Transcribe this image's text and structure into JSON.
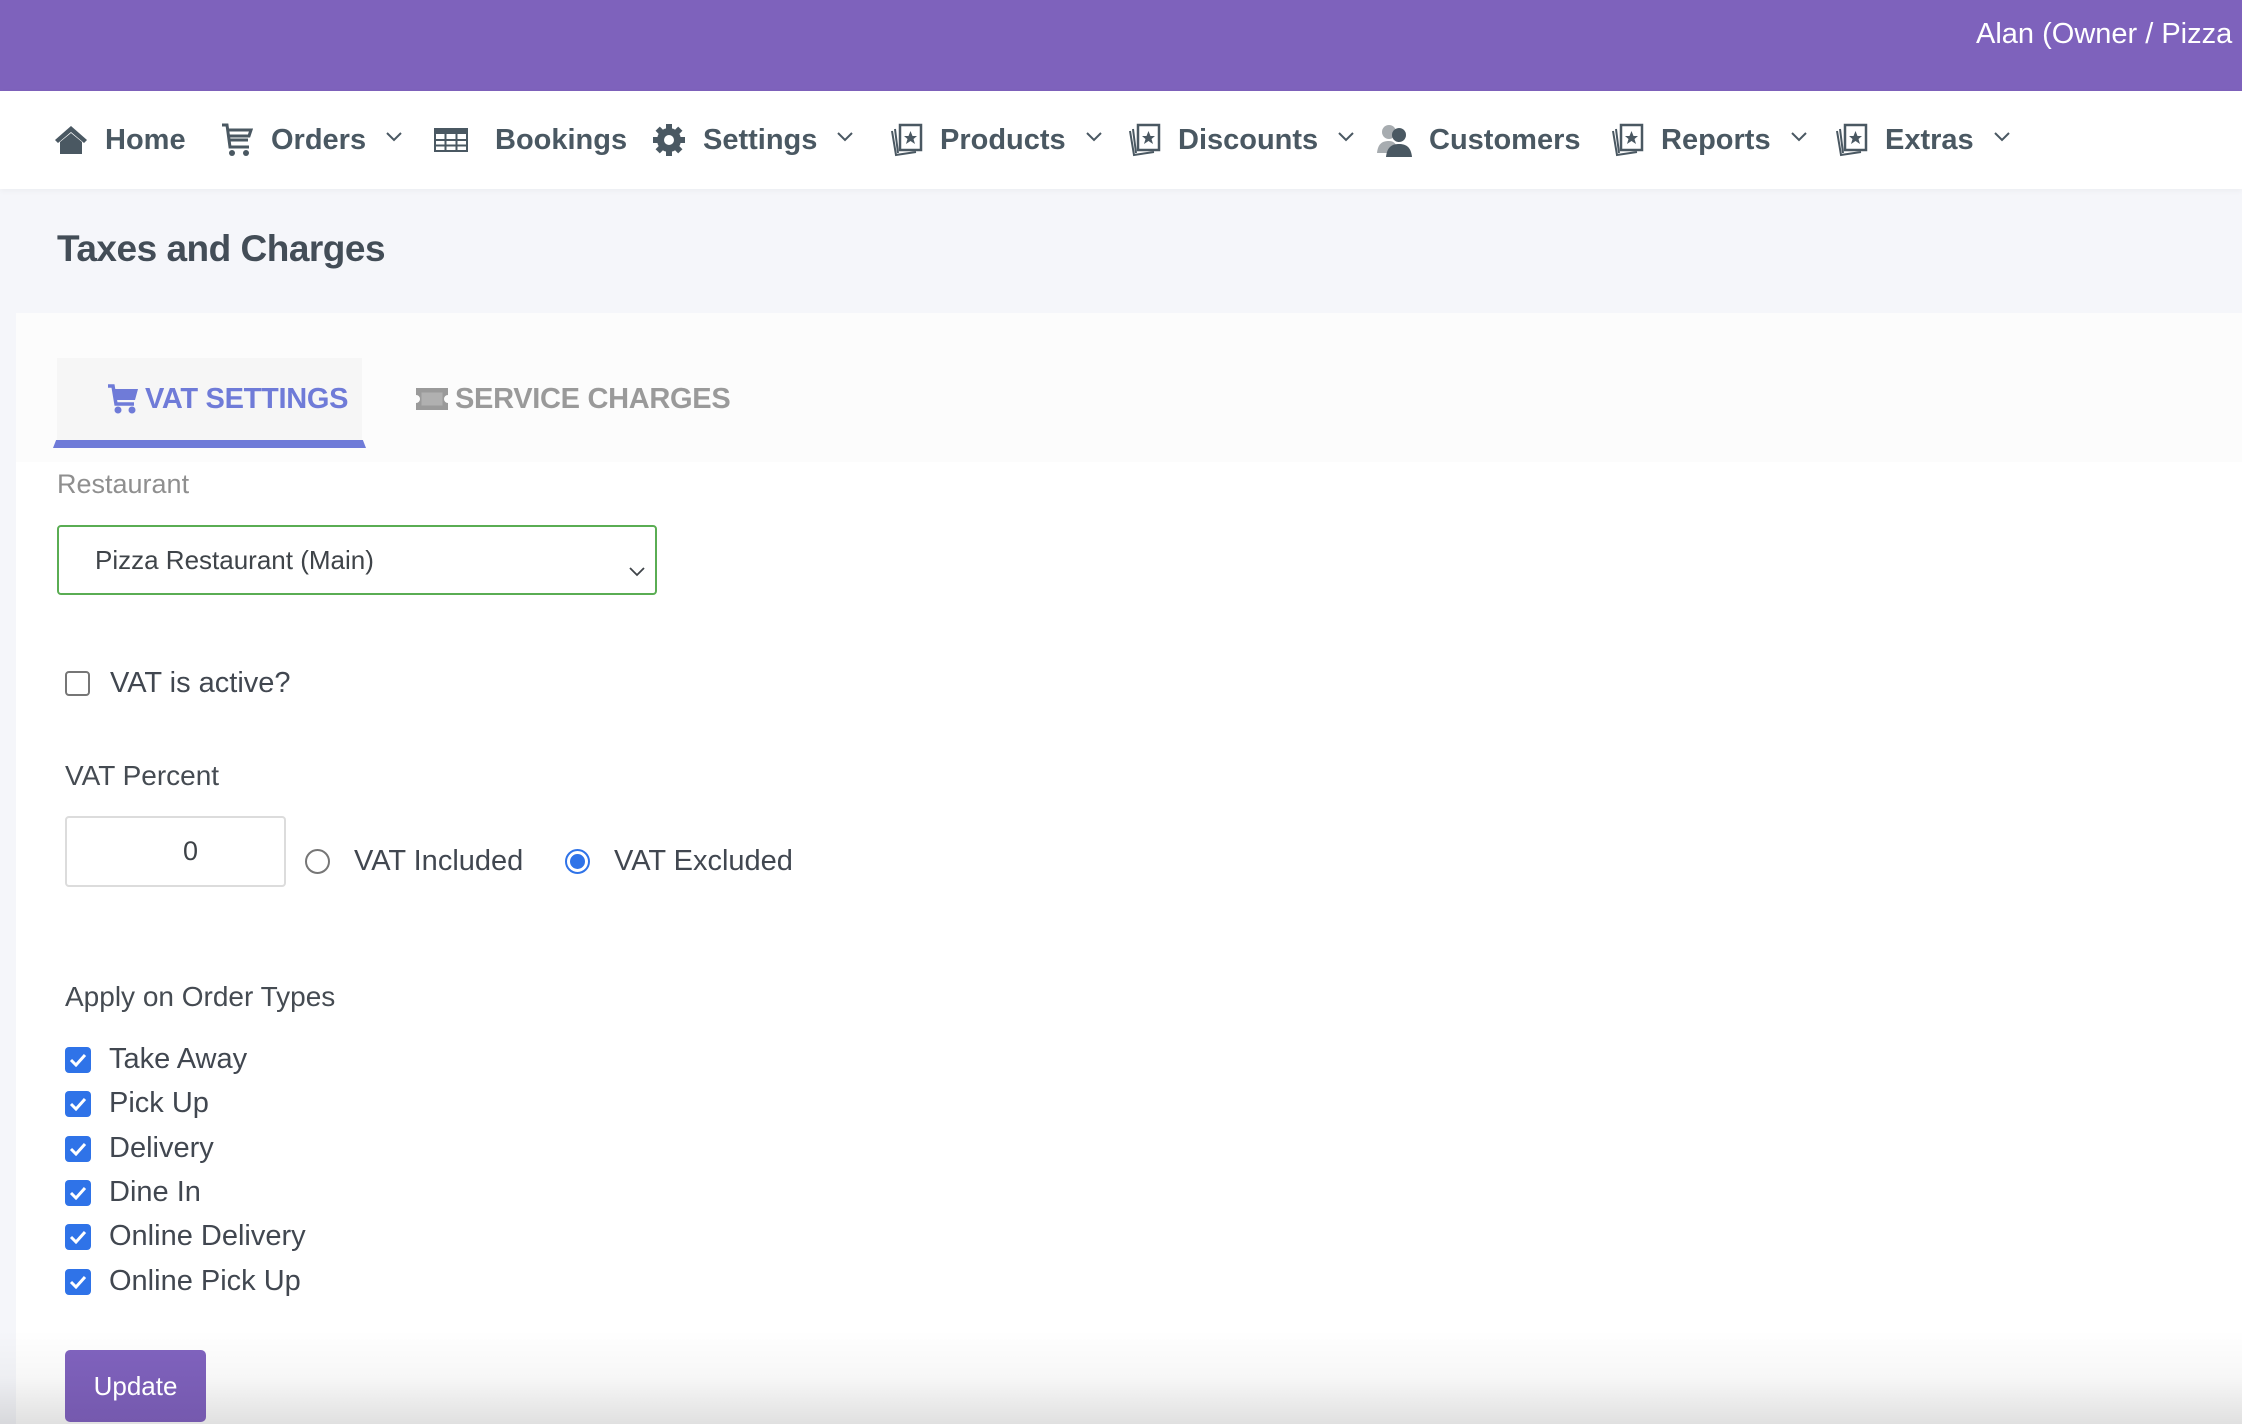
{
  "topbar": {
    "user_label": "Alan (Owner / Pizza R",
    "color": "#7e62bc"
  },
  "nav": {
    "items": [
      {
        "label": "Home",
        "icon": "home-icon",
        "has_dropdown": false
      },
      {
        "label": "Orders",
        "icon": "cart-icon",
        "has_dropdown": true
      },
      {
        "label": "Bookings",
        "icon": "table-icon",
        "has_dropdown": false
      },
      {
        "label": "Settings",
        "icon": "gear-icon",
        "has_dropdown": true
      },
      {
        "label": "Products",
        "icon": "cards-star-icon",
        "has_dropdown": true
      },
      {
        "label": "Discounts",
        "icon": "cards-star-icon",
        "has_dropdown": true
      },
      {
        "label": "Customers",
        "icon": "users-icon",
        "has_dropdown": false
      },
      {
        "label": "Reports",
        "icon": "cards-star-icon",
        "has_dropdown": true
      },
      {
        "label": "Extras",
        "icon": "cards-star-icon",
        "has_dropdown": true
      }
    ]
  },
  "page": {
    "title": "Taxes and Charges"
  },
  "tabs": [
    {
      "label": "VAT SETTINGS",
      "icon": "cart-icon",
      "active": true
    },
    {
      "label": "SERVICE CHARGES",
      "icon": "ticket-icon",
      "active": false
    }
  ],
  "form": {
    "restaurant_label": "Restaurant",
    "restaurant_selected": "Pizza Restaurant (Main)",
    "vat_active_label": "VAT is active?",
    "vat_active_checked": false,
    "vat_percent_label": "VAT Percent",
    "vat_percent_value": "0",
    "vat_mode_options": [
      {
        "label": "VAT Included",
        "selected": false
      },
      {
        "label": "VAT Excluded",
        "selected": true
      }
    ],
    "order_types_label": "Apply on Order Types",
    "order_types": [
      {
        "label": "Take Away",
        "checked": true
      },
      {
        "label": "Pick Up",
        "checked": true
      },
      {
        "label": "Delivery",
        "checked": true
      },
      {
        "label": "Dine In",
        "checked": true
      },
      {
        "label": "Online Delivery",
        "checked": true
      },
      {
        "label": "Online Pick Up",
        "checked": true
      }
    ],
    "submit_label": "Update"
  },
  "colors": {
    "accent": "#7e62bc",
    "tab_active": "#6f7bd8",
    "checkbox": "#2f73e8",
    "select_border": "#5aad53"
  }
}
